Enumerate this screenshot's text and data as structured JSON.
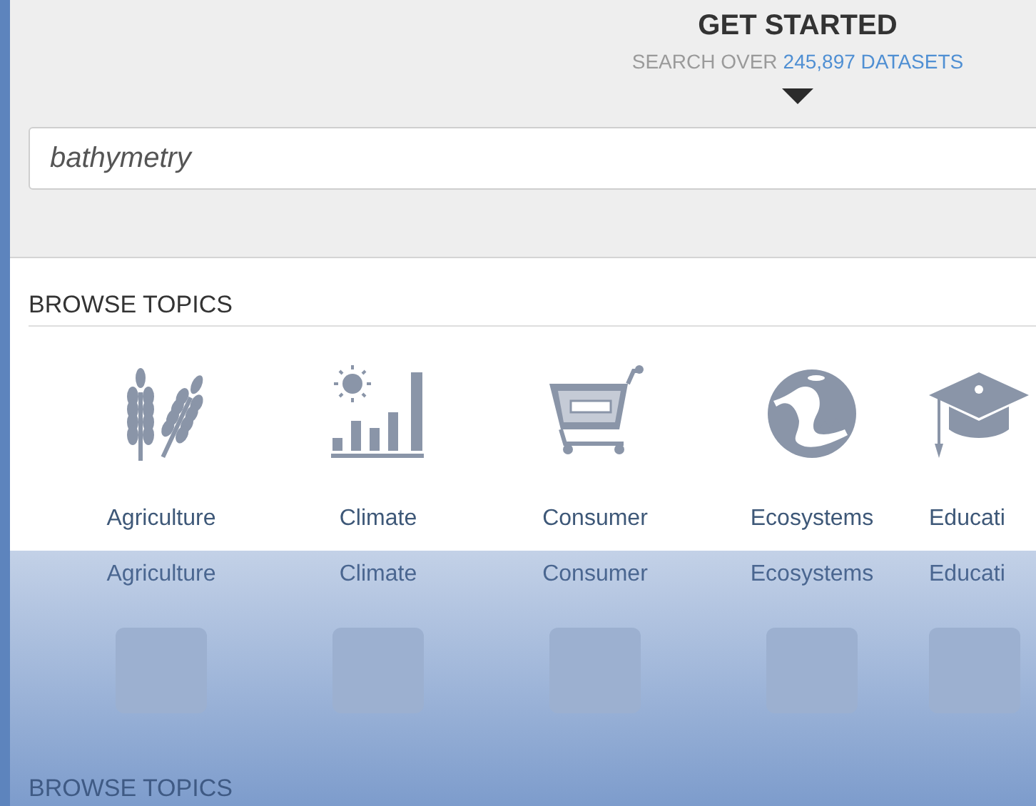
{
  "hero": {
    "title": "GET STARTED",
    "subtitle": "SEARCH OVER",
    "count_link": "245,897 DATASETS"
  },
  "search": {
    "value": "bathymetry"
  },
  "browse": {
    "heading": "BROWSE TOPICS",
    "topics": [
      {
        "label": "Agriculture"
      },
      {
        "label": "Climate"
      },
      {
        "label": "Consumer"
      },
      {
        "label": "Ecosystems"
      },
      {
        "label": "Educati"
      }
    ]
  },
  "reflection": {
    "topics": [
      "Agriculture",
      "Climate",
      "Consumer",
      "Ecosystems",
      "Educati"
    ],
    "heading": "BROWSE TOPICS"
  }
}
